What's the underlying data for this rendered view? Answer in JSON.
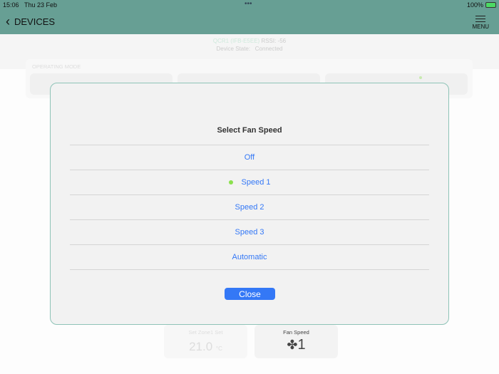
{
  "status": {
    "time": "15:06",
    "date": "Thu 23 Feb",
    "battery": "100%"
  },
  "nav": {
    "back_label": "DEVICES",
    "menu_label": "MENU"
  },
  "device": {
    "name": "QCR1 (IFB-E5EE)",
    "rssi": "RSSI: -56",
    "state_label": "Device State:",
    "state": "Connected"
  },
  "operating_mode": {
    "label": "OPERATING MODE"
  },
  "cards": [
    {
      "title": "Set Zone1 Set",
      "value": "21.0",
      "unit": "°C"
    },
    {
      "title": "Fan Speed",
      "value": "1"
    }
  ],
  "dialog": {
    "title": "Select Fan Speed",
    "options": [
      "Off",
      "Speed 1",
      "Speed 2",
      "Speed 3",
      "Automatic"
    ],
    "selected": "Speed 1",
    "close_label": "Close"
  }
}
